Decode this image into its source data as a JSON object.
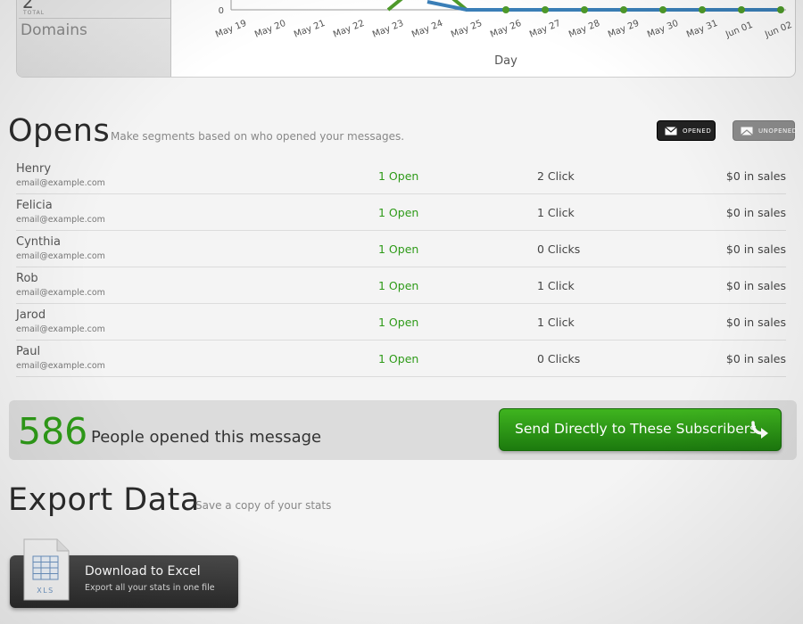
{
  "stats": {
    "count": "2",
    "total_label": "TOTAL",
    "label": "Domains"
  },
  "chart_data": {
    "type": "line",
    "categories": [
      "May 19",
      "May 20",
      "May 21",
      "May 22",
      "May 23",
      "May 24",
      "May 25",
      "May 26",
      "May 27",
      "May 28",
      "May 29",
      "May 30",
      "May 31",
      "Jun 01",
      "Jun 02"
    ],
    "xlabel": "Day",
    "ylabel": "",
    "y_tick_visible": "0",
    "series": [
      {
        "color": "#4e9a2a",
        "values": [
          null,
          null,
          null,
          null,
          0,
          12,
          0,
          0,
          0,
          0,
          0,
          0,
          0,
          0,
          0
        ]
      },
      {
        "color": "#3a7fb8",
        "values": [
          null,
          null,
          null,
          null,
          null,
          3,
          0,
          0,
          0,
          0,
          0,
          0,
          0,
          0,
          0
        ]
      }
    ],
    "grid": false
  },
  "opens": {
    "title": "Opens",
    "subtitle": "Make segments based on who opened your messages.",
    "opened_label": "OPENED",
    "unopened_label": "UNOPENED",
    "rows": [
      {
        "name": "Henry",
        "email": "email@example.com",
        "opens": "1 Open",
        "clicks": "2 Click",
        "sales": "$0 in sales"
      },
      {
        "name": "Felicia",
        "email": "email@example.com",
        "opens": "1 Open",
        "clicks": "1 Click",
        "sales": "$0 in sales"
      },
      {
        "name": "Cynthia",
        "email": "email@example.com",
        "opens": "1 Open",
        "clicks": "0 Clicks",
        "sales": "$0 in sales"
      },
      {
        "name": "Rob",
        "email": "email@example.com",
        "opens": "1 Open",
        "clicks": "1 Click",
        "sales": "$0 in sales"
      },
      {
        "name": "Jarod",
        "email": "email@example.com",
        "opens": "1 Open",
        "clicks": "1 Click",
        "sales": "$0 in sales"
      },
      {
        "name": "Paul",
        "email": "email@example.com",
        "opens": "1 Open",
        "clicks": "0 Clicks",
        "sales": "$0 in sales"
      }
    ]
  },
  "summary": {
    "count": "586",
    "label": "People opened this message",
    "send_button": "Send Directly to These Subscribers"
  },
  "export": {
    "title": "Export Data",
    "subtitle": "Save a copy of your stats",
    "download_title": "Download to Excel",
    "download_sub": "Export all your stats in one file",
    "file_badge": "XLS"
  },
  "colors": {
    "accent_green": "#2e9a18",
    "button_dark": "#2a2a2a"
  },
  "icons": [
    "envelope-icon",
    "envelope-icon",
    "curved-arrow-icon",
    "xls-file-icon"
  ]
}
